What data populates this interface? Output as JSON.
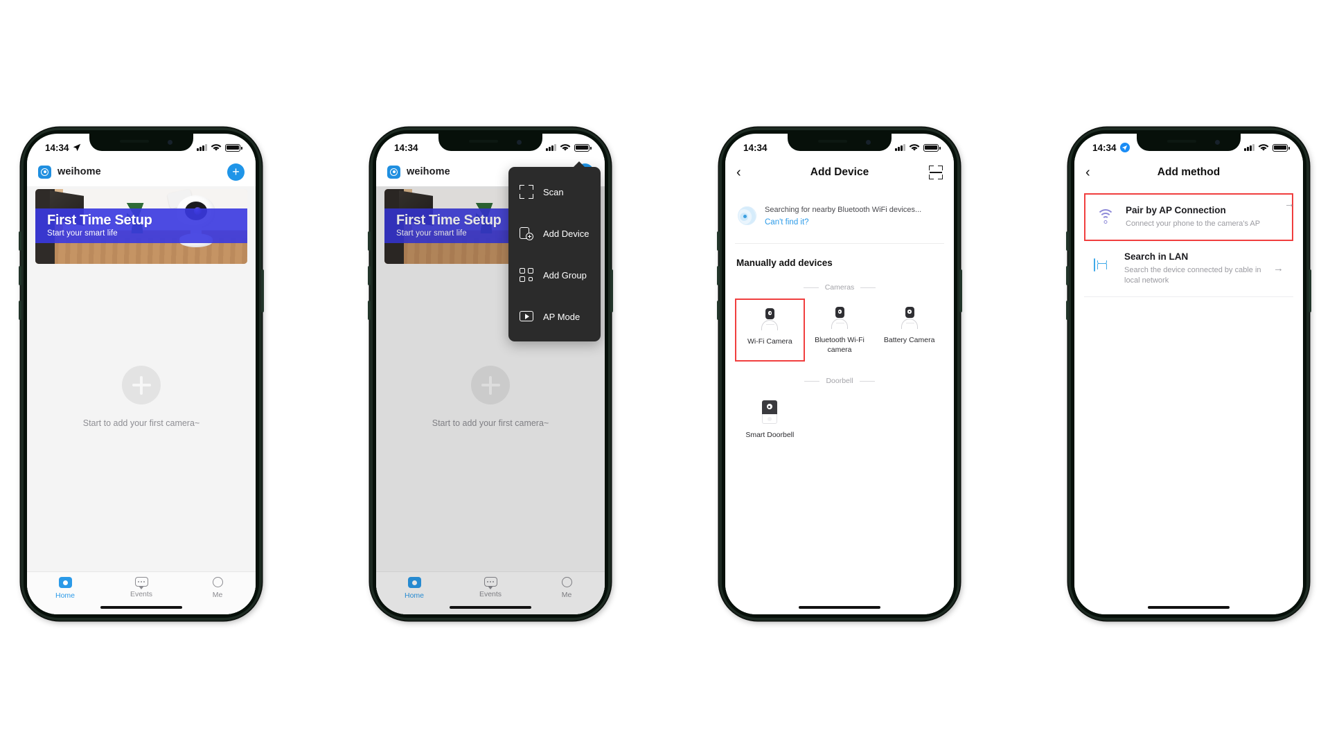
{
  "status_bar": {
    "time": "14:34",
    "location_icon": "location-arrow-icon",
    "signal_icon": "cellular-bars-icon",
    "wifi_icon": "wifi-icon",
    "battery_icon": "battery-icon"
  },
  "phone1": {
    "app_title": "weihome",
    "app_logo_icon": "app-logo-icon",
    "add_button_label": "+",
    "banner": {
      "title": "First Time Setup",
      "subtitle": "Start your smart life"
    },
    "empty_state": {
      "plus_label": "+",
      "text": "Start to add your first camera~"
    },
    "tabs": [
      {
        "label": "Home",
        "icon": "home-icon",
        "active": true
      },
      {
        "label": "Events",
        "icon": "events-icon",
        "active": false
      },
      {
        "label": "Me",
        "icon": "profile-icon",
        "active": false
      }
    ]
  },
  "phone2": {
    "app_title": "weihome",
    "add_button_label": "+",
    "banner": {
      "title": "First Time Setup",
      "subtitle": "Start your smart life"
    },
    "empty_state": {
      "plus_label": "+",
      "text": "Start to add your first camera~"
    },
    "dropdown": [
      {
        "label": "Scan",
        "icon": "scan-icon"
      },
      {
        "label": "Add Device",
        "icon": "add-device-icon"
      },
      {
        "label": "Add Group",
        "icon": "add-group-icon"
      },
      {
        "label": "AP Mode",
        "icon": "ap-mode-icon"
      }
    ],
    "tabs": [
      {
        "label": "Home",
        "icon": "home-icon",
        "active": true
      },
      {
        "label": "Events",
        "icon": "events-icon",
        "active": false
      },
      {
        "label": "Me",
        "icon": "profile-icon",
        "active": false
      }
    ]
  },
  "phone3": {
    "nav": {
      "back_icon": "back-chevron-icon",
      "title": "Add Device",
      "scan_icon": "scan-icon"
    },
    "search": {
      "radar_icon": "radar-icon",
      "status_text": "Searching for nearby Bluetooth WiFi devices...",
      "cant_find_link": "Can't find it?"
    },
    "section_title": "Manually add devices",
    "groups": [
      {
        "label": "Cameras",
        "devices": [
          {
            "name": "Wi-Fi Camera",
            "icon": "wifi-camera-icon",
            "selected": true
          },
          {
            "name": "Bluetooth Wi-Fi camera",
            "icon": "bluetooth-camera-icon",
            "selected": false
          },
          {
            "name": "Battery Camera",
            "icon": "battery-camera-icon",
            "selected": false
          }
        ]
      },
      {
        "label": "Doorbell",
        "devices": [
          {
            "name": "Smart Doorbell",
            "icon": "doorbell-icon",
            "selected": false
          }
        ]
      }
    ]
  },
  "phone4": {
    "nav": {
      "back_icon": "back-chevron-icon",
      "title": "Add method"
    },
    "methods": [
      {
        "title": "Pair by AP Connection",
        "subtitle": "Connect your phone to the camera's AP",
        "icon": "wifi-icon",
        "arrow": "→",
        "selected": true
      },
      {
        "title": "Search in LAN",
        "subtitle": "Search the device connected by cable in local network",
        "icon": "lan-icon",
        "arrow": "→",
        "selected": false
      }
    ]
  },
  "highlight_color": "#f03e3e",
  "accent_color": "#1f95e8"
}
